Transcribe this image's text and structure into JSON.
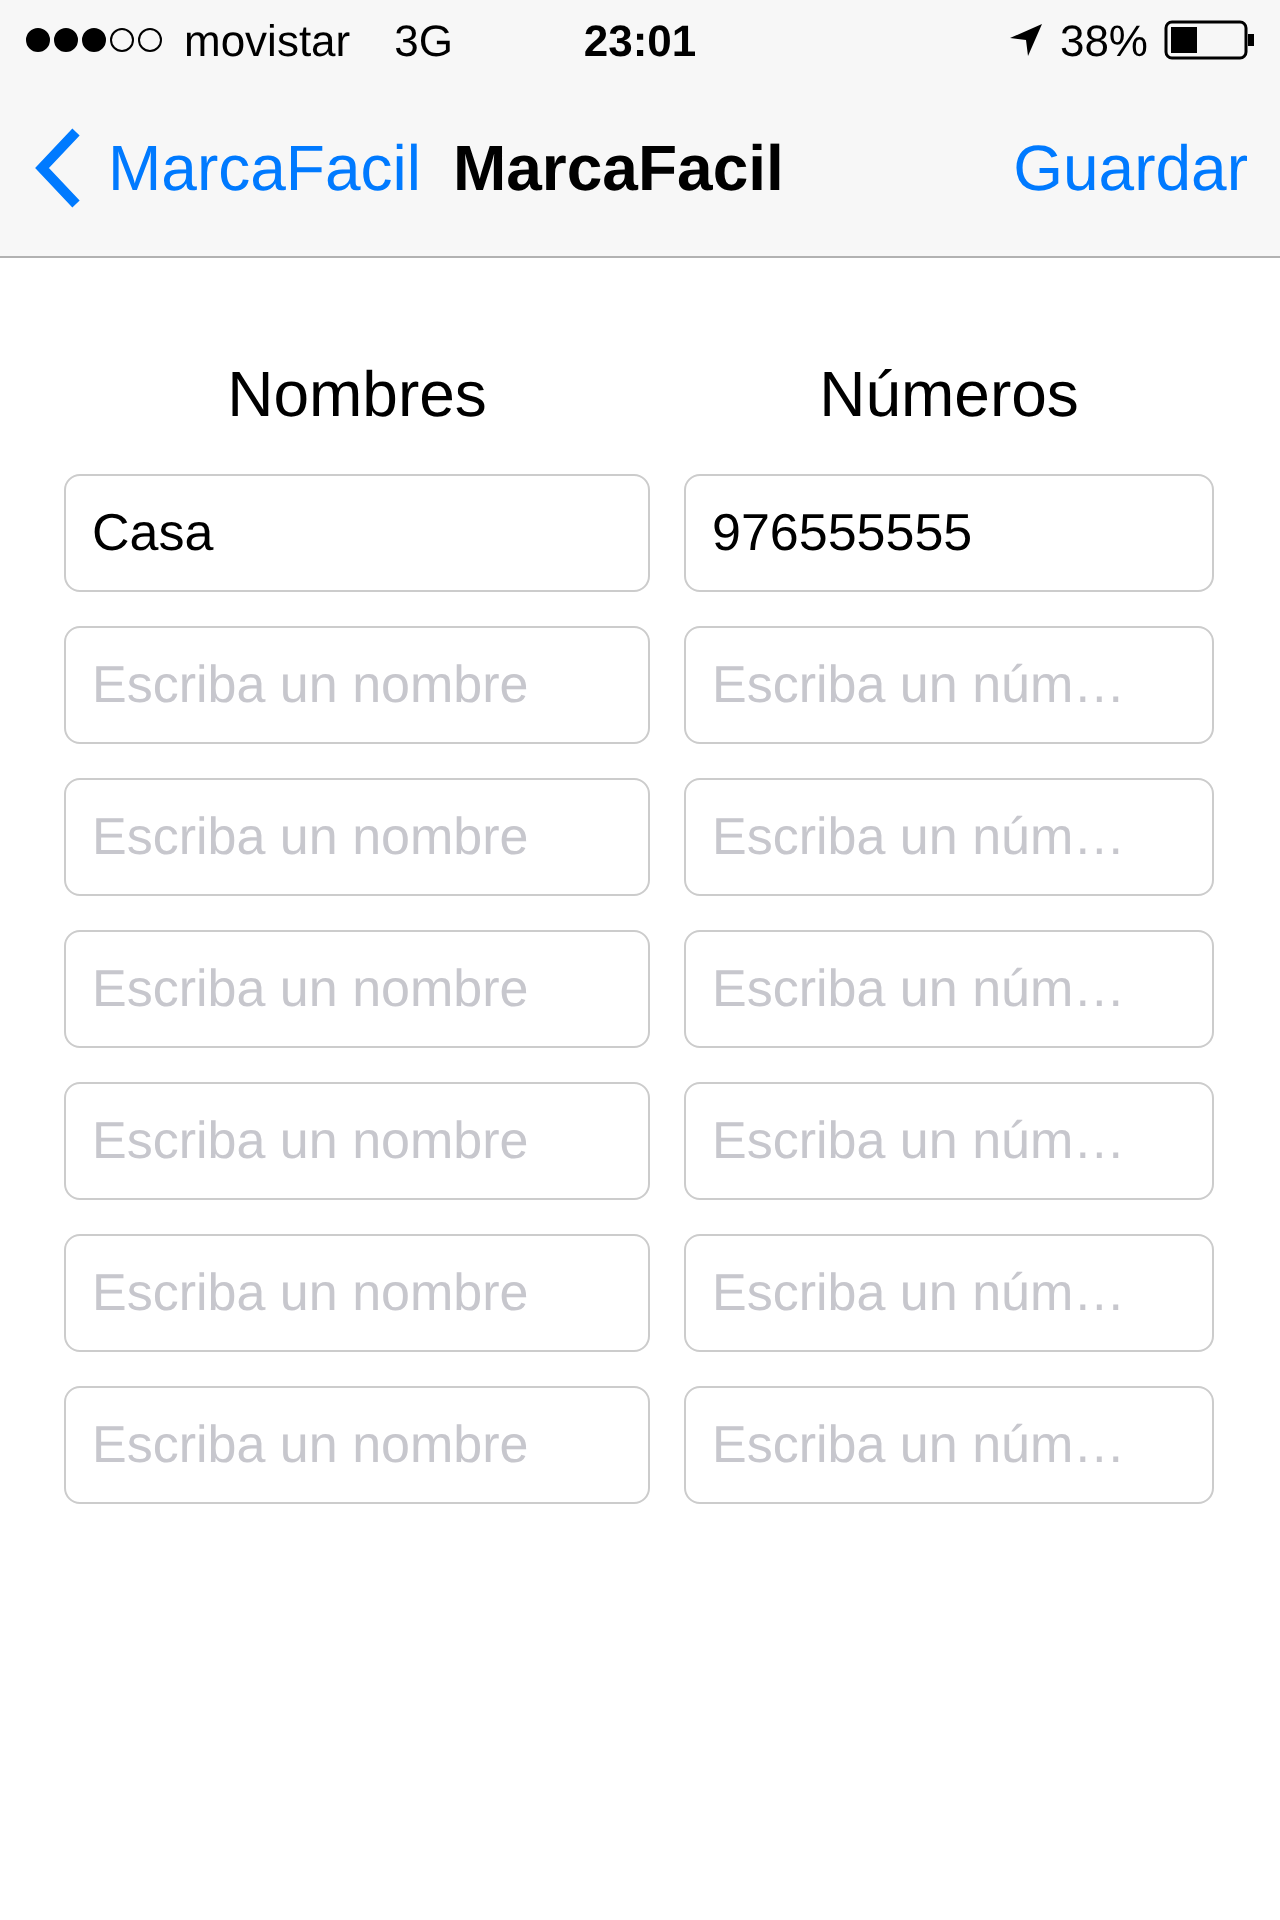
{
  "status_bar": {
    "carrier": "movistar",
    "network": "3G",
    "time": "23:01",
    "battery": "38%"
  },
  "nav_bar": {
    "back": "MarcaFacil",
    "title": "MarcaFacil",
    "action": "Guardar"
  },
  "columns": [
    "Nombres",
    "Números"
  ],
  "rows": [
    {
      "name": {
        "value": "Casa"
      },
      "number": {
        "value": "976555555"
      }
    },
    {
      "name": {
        "placeholder": "Escriba un nombre"
      },
      "number": {
        "placeholder": "Escriba un núm…"
      }
    },
    {
      "name": {
        "placeholder": "Escriba un nombre"
      },
      "number": {
        "placeholder": "Escriba un núm…"
      }
    },
    {
      "name": {
        "placeholder": "Escriba un nombre"
      },
      "number": {
        "placeholder": "Escriba un núm…"
      }
    },
    {
      "name": {
        "placeholder": "Escriba un nombre"
      },
      "number": {
        "placeholder": "Escriba un núm…"
      }
    },
    {
      "name": {
        "placeholder": "Escriba un nombre"
      },
      "number": {
        "placeholder": "Escriba un núm…"
      }
    },
    {
      "name": {
        "placeholder": "Escriba un nombre"
      },
      "number": {
        "placeholder": "Escriba un núm…"
      }
    }
  ]
}
